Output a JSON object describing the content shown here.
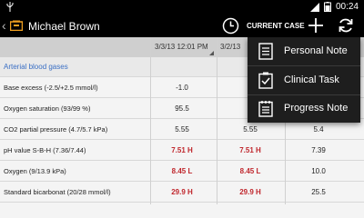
{
  "status_bar": {
    "time": "00:24"
  },
  "action_bar": {
    "back": "‹",
    "title": "Michael Brown",
    "current_case": "CURRENT CASE"
  },
  "columns": {
    "col1": "3/3/13 12:01 PM",
    "col2": "3/2/13"
  },
  "section": {
    "label": "Arterial blood gases"
  },
  "rows": [
    {
      "label": "Base excess (-2.5/+2.5 mmol/l)",
      "v1": "-1.0",
      "v2": "",
      "v3": ""
    },
    {
      "label": "Oxygen saturation (93/99 %)",
      "v1": "95.5",
      "v2": "",
      "v3": ""
    },
    {
      "label": "CO2 partial pressure (4.7/5.7 kPa)",
      "v1": "5.55",
      "v2": "5.55",
      "v3": "5.4"
    },
    {
      "label": "pH value S-B-H (7.36/7.44)",
      "v1": "7.51 H",
      "v2": "7.51 H",
      "v3": "7.39"
    },
    {
      "label": "Oxygen (9/13.9 kPa)",
      "v1": "8.45 L",
      "v2": "8.45 L",
      "v3": "10.0"
    },
    {
      "label": "Standard bicarbonat (20/28 mmol/l)",
      "v1": "29.9 H",
      "v2": "29.9 H",
      "v3": "25.5"
    }
  ],
  "menu": {
    "items": [
      {
        "label": "Personal Note",
        "icon": "personal-note-icon"
      },
      {
        "label": "Clinical Task",
        "icon": "clinical-task-icon"
      },
      {
        "label": "Progress Note",
        "icon": "progress-note-icon"
      }
    ]
  },
  "colors": {
    "abnormal": "#c0272d",
    "section": "#3a6fc4",
    "logo": "#f0a020"
  }
}
